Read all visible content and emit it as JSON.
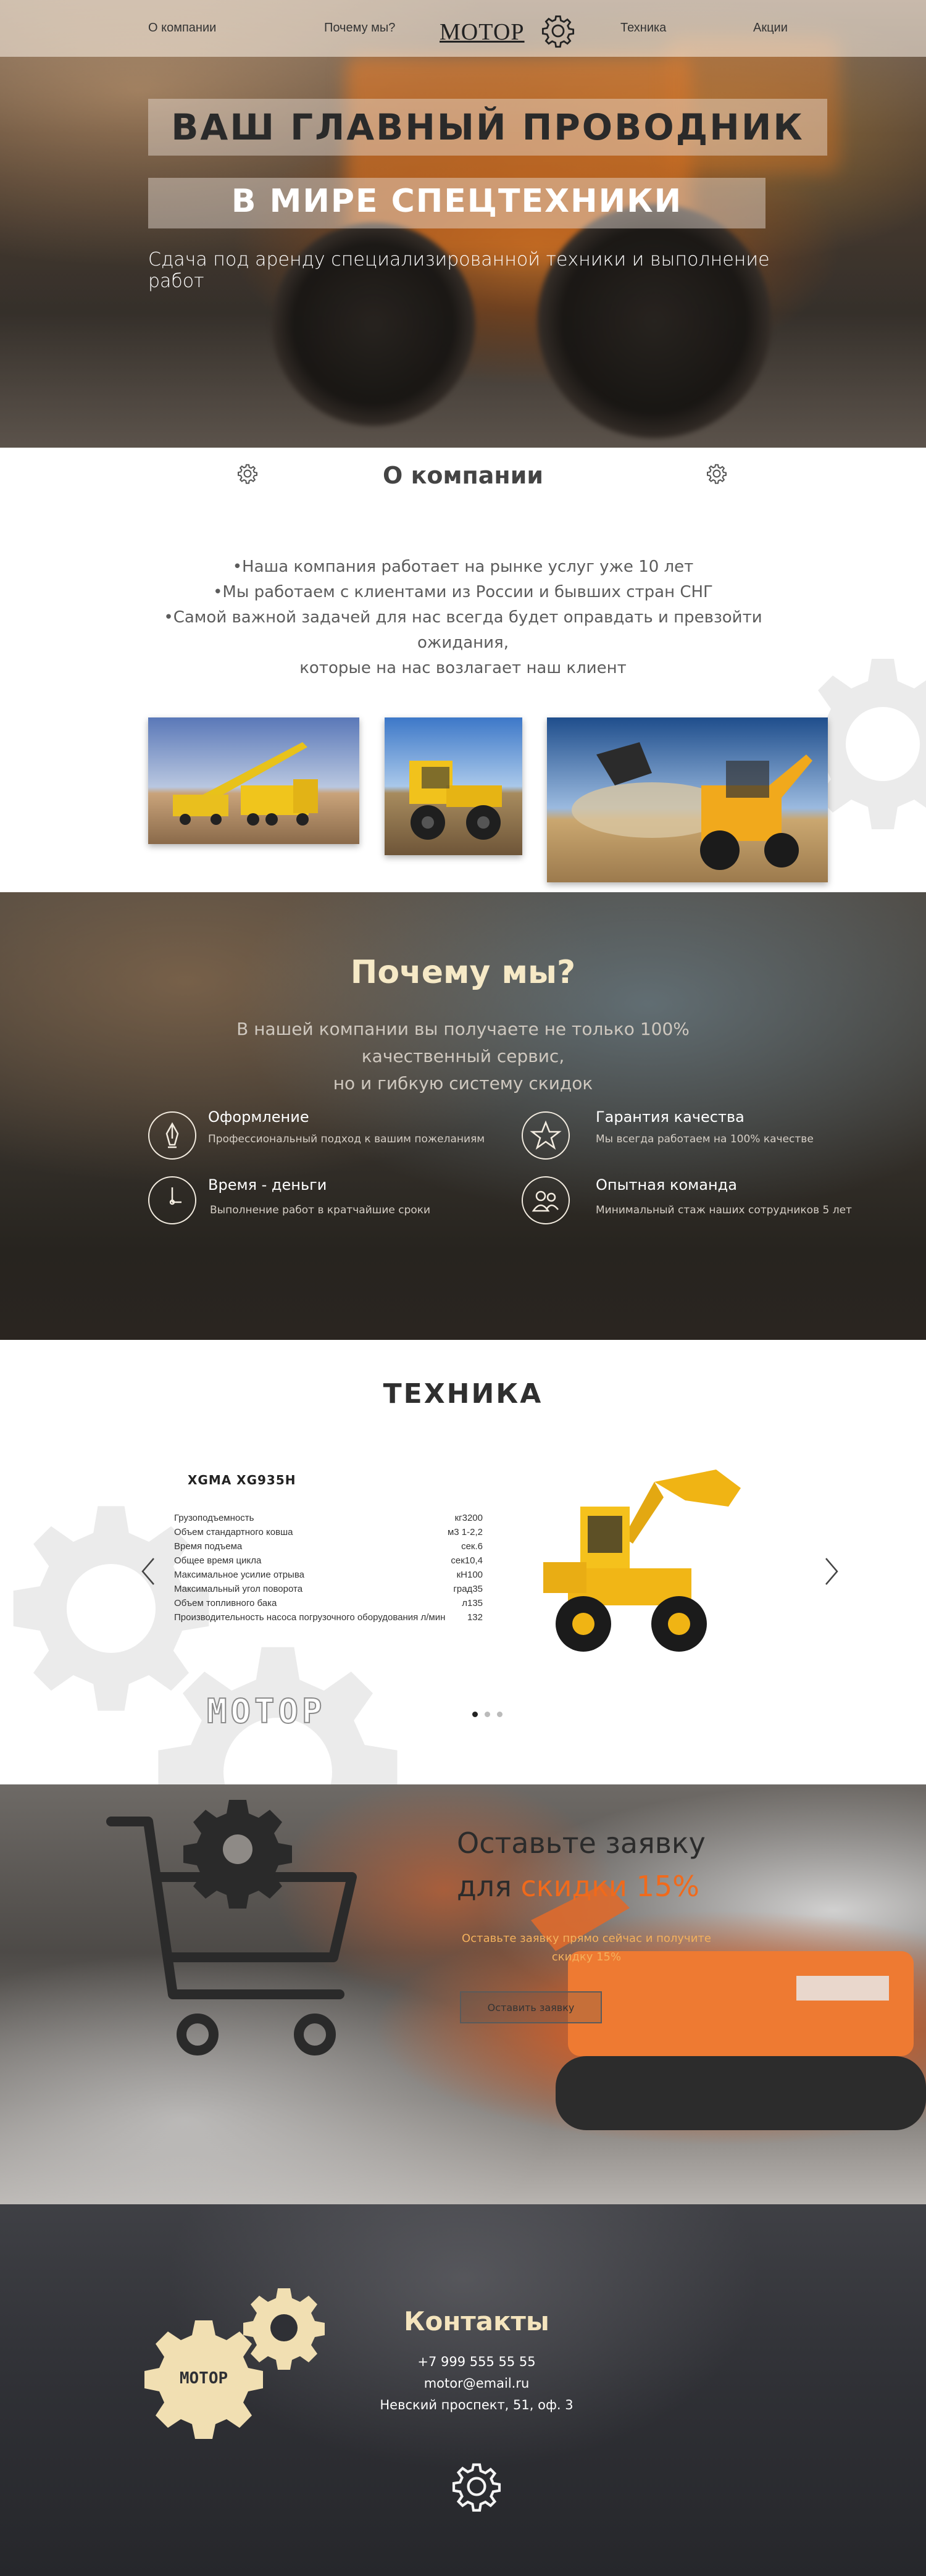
{
  "nav": {
    "about": "О компании",
    "why": "Почему мы?",
    "logo": "МОТОР",
    "tech": "Техника",
    "promo": "Акции"
  },
  "hero": {
    "title_line1": "ВАШ ГЛАВНЫЙ ПРОВОДНИК",
    "title_line2": "В МИРЕ СПЕЦТЕХНИКИ",
    "subtitle": "Сдача под аренду специализированной техники и выполнение работ"
  },
  "about": {
    "title": "О компании",
    "points": [
      "•Наша компания работает на рынке услуг уже 10 лет",
      "•Мы работаем с клиентами из России и бывших стран СНГ",
      "•Самой важной задачей для нас всегда будет оправдать и превзойти ожидания,",
      "которые на нас возлагает наш клиент"
    ]
  },
  "why": {
    "title": "Почему мы?",
    "text_line1": "В нашей компании вы получаете не только 100% качественный сервис,",
    "text_line2": "но и гибкую систему скидок",
    "features": [
      {
        "icon": "pen-icon",
        "title": "Оформление",
        "desc": "Профессиональный подход к вашим пожеланиям"
      },
      {
        "icon": "star-icon",
        "title": "Гарантия качества",
        "desc": "Мы всегда работаем на 100% качестве"
      },
      {
        "icon": "clock-icon",
        "title": "Время - деньги",
        "desc": "Выполнение работ в кратчайшие сроки"
      },
      {
        "icon": "team-icon",
        "title": "Опытная команда",
        "desc": "Минимальный стаж наших сотрудников 5 лет"
      }
    ]
  },
  "tech": {
    "title": "ТЕХНИКА",
    "model": "XGMA XG935H",
    "specs": [
      {
        "k": "Грузоподъемность",
        "v": "кг3200"
      },
      {
        "k": "Объем стандартного ковша",
        "v": "м3 1-2,2"
      },
      {
        "k": "Время подъема",
        "v": "сек.6"
      },
      {
        "k": "Общее время цикла",
        "v": "сек10,4"
      },
      {
        "k": "Максимальное усилие отрыва",
        "v": "кН100"
      },
      {
        "k": "Максимальный угол поворота",
        "v": "град35"
      },
      {
        "k": "Объем топливного бака",
        "v": "л135"
      },
      {
        "k": "Производительность насоса погрузочного оборудования л/мин",
        "v": "132"
      }
    ],
    "stamp": "МОТОР",
    "slides_total": 3,
    "slide_active": 1
  },
  "order": {
    "title_line1": "Оставьте заявку",
    "title_line2_prefix": "для ",
    "title_line2_accent": "скидки 15%",
    "desc": "Оставьте заявку прямо сейчас и получите скидку 15%",
    "button": "Оставить заявку"
  },
  "contacts": {
    "title": "Контакты",
    "phone": "+7 999 555 55 55",
    "email": "motor@email.ru",
    "address": "Невский проспект, 51, оф. 3",
    "gear_logo": "МОТОР"
  },
  "colors": {
    "accent_orange": "#f06a1c",
    "cream": "#f6e9c6",
    "dark": "#2f2f2f"
  }
}
